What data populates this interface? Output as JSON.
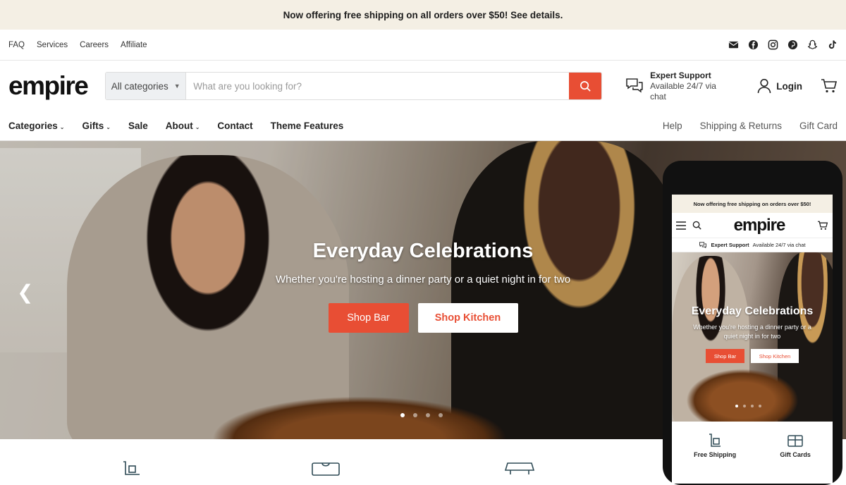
{
  "announcement": "Now offering free shipping on all orders over $50! See details.",
  "utility_links": [
    "FAQ",
    "Services",
    "Careers",
    "Affiliate"
  ],
  "social_icons": [
    "mail-icon",
    "facebook-icon",
    "instagram-icon",
    "pinterest-icon",
    "snapchat-icon",
    "tiktok-icon"
  ],
  "brand": {
    "logo": "empire",
    "accent": "#e84e34"
  },
  "search": {
    "category": "All categories",
    "placeholder": "What are you looking for?"
  },
  "support": {
    "title": "Expert Support",
    "subtitle": "Available 24/7 via chat"
  },
  "login": "Login",
  "nav": {
    "left": [
      {
        "label": "Categories"
      },
      {
        "label": "Gifts"
      },
      {
        "label": "Sale"
      },
      {
        "label": "About"
      },
      {
        "label": "Contact"
      },
      {
        "label": "Theme Features"
      }
    ],
    "right": [
      "Help",
      "Shipping & Returns",
      "Gift Card"
    ]
  },
  "hero": {
    "title": "Everyday Celebrations",
    "subtitle": "Whether you're hosting a dinner party or a quiet night in for two",
    "btn_primary": "Shop Bar",
    "btn_secondary": "Shop Kitchen",
    "active_slide": 1,
    "slide_count": 4
  },
  "mobile": {
    "announcement": "Now offering free shipping on orders over $50!",
    "logo": "empire",
    "support_title": "Expert Support",
    "support_subtitle": "Available 24/7 via chat",
    "hero_title": "Everyday Celebrations",
    "hero_subtitle": "Whether you're hosting a dinner party or a quiet night in for two",
    "btn_primary": "Shop Bar",
    "btn_secondary": "Shop Kitchen",
    "features": [
      "Free Shipping",
      "Gift Cards"
    ]
  }
}
